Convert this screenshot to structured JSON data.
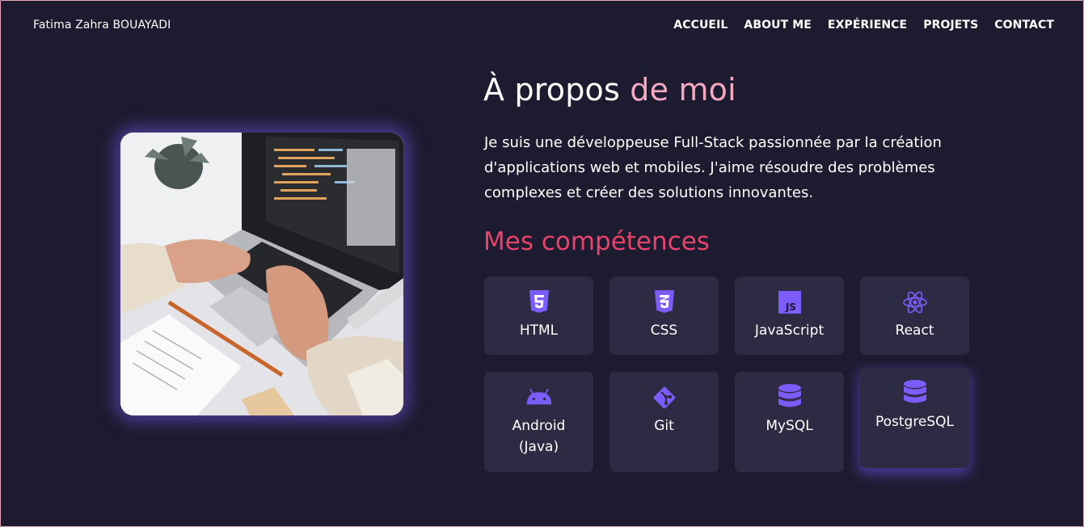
{
  "header": {
    "brand": "Fatima Zahra BOUAYADI",
    "nav": [
      "ACCUEIL",
      "ABOUT ME",
      "EXPÉRIENCE",
      "PROJETS",
      "CONTACT"
    ]
  },
  "about": {
    "title_part1": "À propos ",
    "title_part2": "de moi",
    "text": "Je suis une développeuse Full-Stack passionnée par la création d'applications web et mobiles. J'aime résoudre des problèmes complexes et créer des solutions innovantes."
  },
  "skills": {
    "title": "Mes compétences",
    "items": [
      {
        "label": "HTML",
        "icon": "html5-icon"
      },
      {
        "label": "CSS",
        "icon": "css3-icon"
      },
      {
        "label": "JavaScript",
        "icon": "javascript-icon"
      },
      {
        "label": "React",
        "icon": "react-icon"
      },
      {
        "label": "Android (Java)",
        "icon": "android-icon"
      },
      {
        "label": "Git",
        "icon": "git-icon"
      },
      {
        "label": "MySQL",
        "icon": "database-icon"
      },
      {
        "label": "PostgreSQL",
        "icon": "database-icon"
      }
    ]
  },
  "colors": {
    "background": "#1c1b2f",
    "card": "#2d2b43",
    "accent_purple": "#7c5cfa",
    "accent_pink": "#f5a9c0",
    "accent_red": "#e8436b"
  }
}
